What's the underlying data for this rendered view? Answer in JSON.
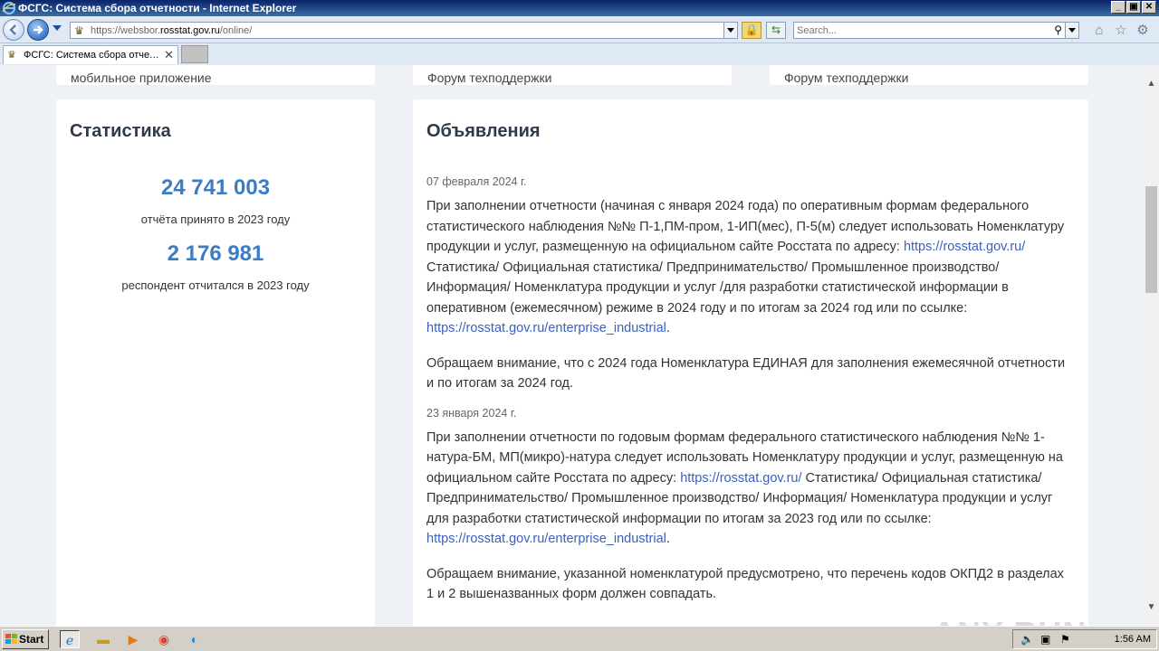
{
  "window": {
    "title": "ФСГС: Система сбора отчетности - Internet Explorer",
    "buttons": {
      "minimize": "_",
      "maximize": "▣",
      "close": "✕"
    }
  },
  "address_bar": {
    "url_prefix": "https://websbor.",
    "url_domain": "rosstat.gov.ru",
    "url_path": "/online/",
    "search_placeholder": "Search..."
  },
  "tabs": [
    {
      "title": "ФСГС: Система сбора отчет...",
      "close": "✕"
    }
  ],
  "top_cards": [
    {
      "cut_text": "мобильное приложение"
    },
    {
      "cut_text": "Форум техподдержки"
    },
    {
      "cut_text": "Форум техподдержки"
    }
  ],
  "statistics": {
    "title": "Статистика",
    "reports_value": "24 741 003",
    "reports_label": "отчёта принято в 2023 году",
    "respondents_value": "2 176 981",
    "respondents_label": "респондент отчитался в 2023 году"
  },
  "announcements": {
    "title": "Объявления",
    "items": [
      {
        "date": "07 февраля 2024 г.",
        "p1_before": "При заполнении отчетности (начиная с января 2024 года) по оперативным формам федерального статистического наблюдения №№ П-1,ПМ-пром, 1-ИП(мес), П-5(м) следует использовать Номенклатуру продукции и услуг, размещенную на официальном сайте Росстата по адресу: ",
        "p1_link1": "https://rosstat.gov.ru/",
        "p1_middle": " Статистика/ Официальная статистика/ Предпринимательство/ Промышленное производство/ Информация/ Номенклатура продукции и услуг /для разработки статистической информации в оперативном (ежемесячном) режиме в 2024 году и по итогам за 2024 год или по ссылке: ",
        "p1_link2": "https://rosstat.gov.ru/enterprise_industrial",
        "p1_end": ".",
        "p2": "Обращаем внимание, что с 2024 года Номенклатура ЕДИНАЯ для заполнения ежемесячной отчетности и по итогам за 2024 год."
      },
      {
        "date": "23 января 2024 г.",
        "p1_before": "При заполнении отчетности по годовым формам федерального статистического наблюдения №№ 1-натура-БМ, МП(микро)-натура следует использовать Номенклатуру продукции и услуг, размещенную на официальном сайте Росстата по адресу: ",
        "p1_link1": "https://rosstat.gov.ru/",
        "p1_middle": " Статистика/ Официальная статистика/ Предпринимательство/ Промышленное производство/ Информация/ Номенклатура продукции и услуг для разработки статистической информации по итогам за 2023 год или по ссылке: ",
        "p1_link2": "https://rosstat.gov.ru/enterprise_industrial",
        "p1_end": ".",
        "p2": "Обращаем внимание, указанной номенклатурой предусмотрено, что перечень кодов ОКПД2 в разделах 1 и 2 вышеназванных форм должен совпадать."
      }
    ]
  },
  "watermark": "ANY RUN",
  "taskbar": {
    "start_label": "Start",
    "clock": "1:56 AM",
    "icons": [
      "ie-icon",
      "folder-icon",
      "media-player-icon",
      "chrome-icon",
      "edge-icon"
    ]
  },
  "colors": {
    "accent_blue": "#3b7cc4",
    "link_blue": "#3b5fc0",
    "page_bg": "#eef2f7",
    "title_bar": "#0a246a"
  }
}
